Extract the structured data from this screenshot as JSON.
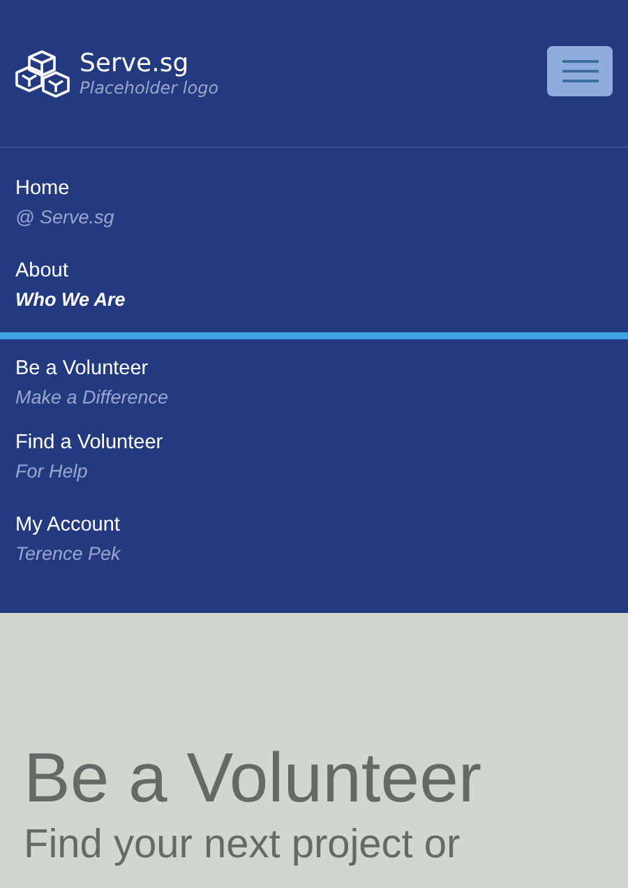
{
  "header": {
    "brand": "Serve.sg",
    "tagline": "Placeholder logo"
  },
  "nav": [
    {
      "title": "Home",
      "subtitle": "@ Serve.sg",
      "selected": false
    },
    {
      "title": "About",
      "subtitle": "Who We Are",
      "selected": true
    },
    {
      "title": "Be a Volunteer",
      "subtitle": "Make a Difference",
      "selected": false
    },
    {
      "title": "Find a Volunteer",
      "subtitle": "For Help",
      "selected": false
    },
    {
      "title": "My Account",
      "subtitle": "Terence Pek",
      "selected": false
    }
  ],
  "hero": {
    "title": "Be a Volunteer",
    "subtitle": "Find your next project or"
  }
}
